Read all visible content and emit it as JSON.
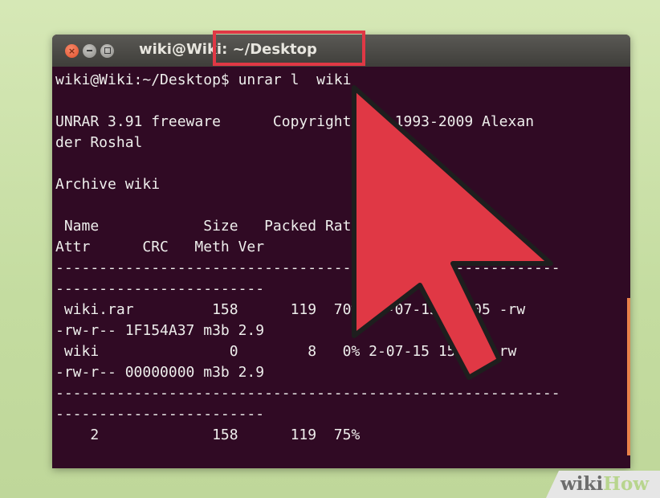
{
  "window": {
    "title": "wiki@Wiki: ~/Desktop"
  },
  "terminal": {
    "prompt": "wiki@Wiki:~/Desktop$ ",
    "command": "unrar l  wiki",
    "lines": [
      "",
      "UNRAR 3.91 freeware      Copyright (c) 1993-2009 Alexan",
      "der Roshal",
      "",
      "Archive wiki",
      "",
      " Name            Size   Packed Ratio  Date   Time",
      "Attr      CRC   Meth Ver",
      "----------------------------------------------------------",
      "------------------------",
      " wiki.rar         158      119  70% 04-07-15 15:05 -rw",
      "-rw-r-- 1F154A37 m3b 2.9",
      " wiki               0        8   0% 2-07-15 15:04 -rw",
      "-rw-r-- 00000000 m3b 2.9",
      "----------------------------------------------------------",
      "------------------------",
      "    2             158      119  75%"
    ]
  },
  "colors": {
    "terminal_bg": "#300a24",
    "terminal_fg": "#eeeeec",
    "highlight": "#e03845",
    "arrow": "#e03845",
    "scrollbar": "#e9824a"
  },
  "overlay": {
    "arrow_icon": "pointer-arrow-icon"
  },
  "logo": {
    "wiki": "wiki",
    "how": "How"
  }
}
